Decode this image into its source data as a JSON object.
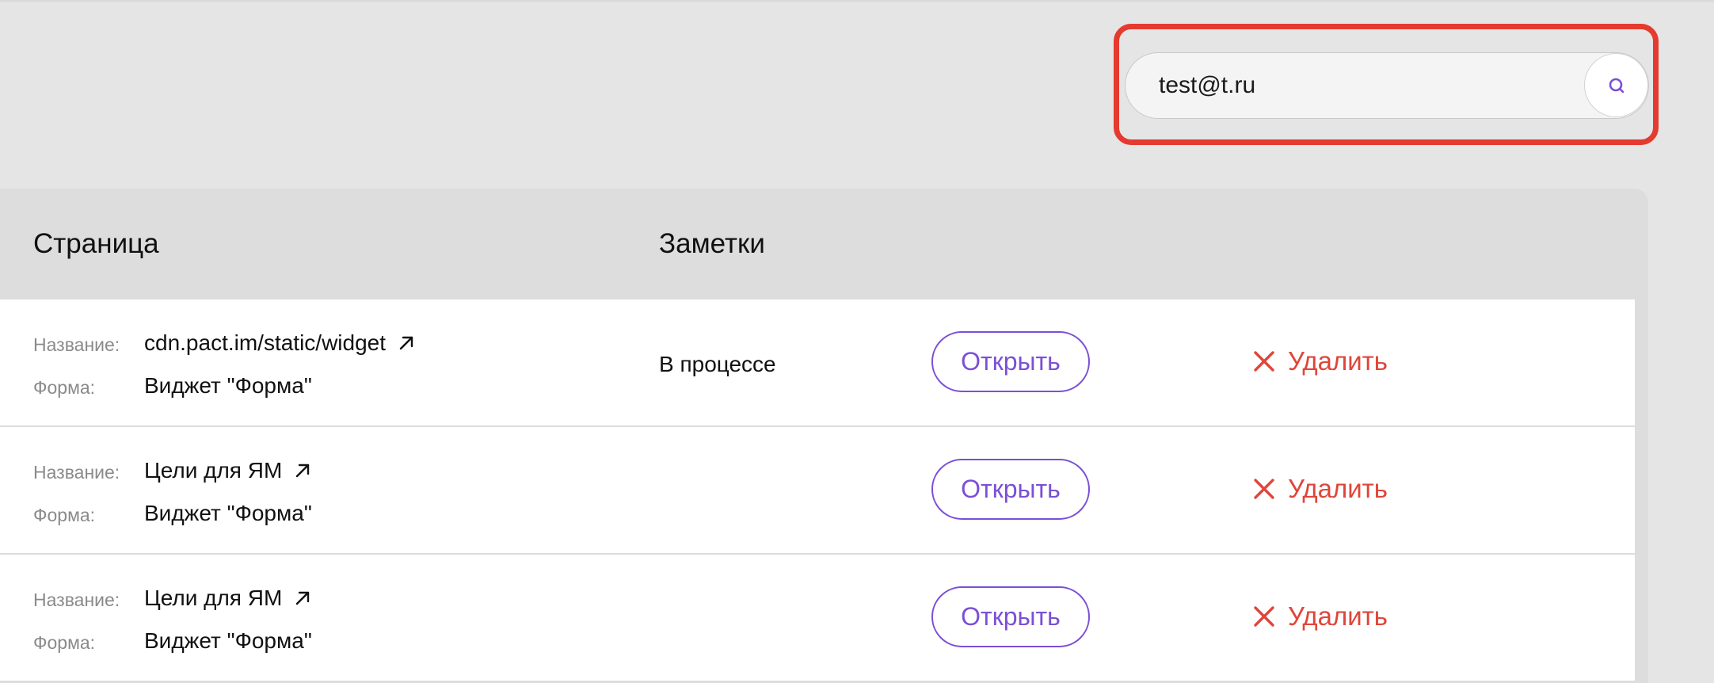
{
  "search": {
    "value": "test@t.ru",
    "icon": "search-icon"
  },
  "colors": {
    "accent": "#7b4fd6",
    "danger": "#e0453a",
    "highlight": "#e53a2f"
  },
  "table": {
    "headers": {
      "page": "Страница",
      "notes": "Заметки"
    },
    "rows": [
      {
        "name_label": "Название:",
        "name": "cdn.pact.im/static/widget",
        "form_label": "Форма:",
        "form": "Виджет \"Форма\"",
        "note": "В процессе",
        "open_label": "Открыть",
        "delete_label": "Удалить"
      },
      {
        "name_label": "Название:",
        "name": "Цели для ЯМ",
        "form_label": "Форма:",
        "form": "Виджет \"Форма\"",
        "note": "",
        "open_label": "Открыть",
        "delete_label": "Удалить"
      },
      {
        "name_label": "Название:",
        "name": "Цели для ЯМ",
        "form_label": "Форма:",
        "form": "Виджет \"Форма\"",
        "note": "",
        "open_label": "Открыть",
        "delete_label": "Удалить"
      }
    ]
  }
}
